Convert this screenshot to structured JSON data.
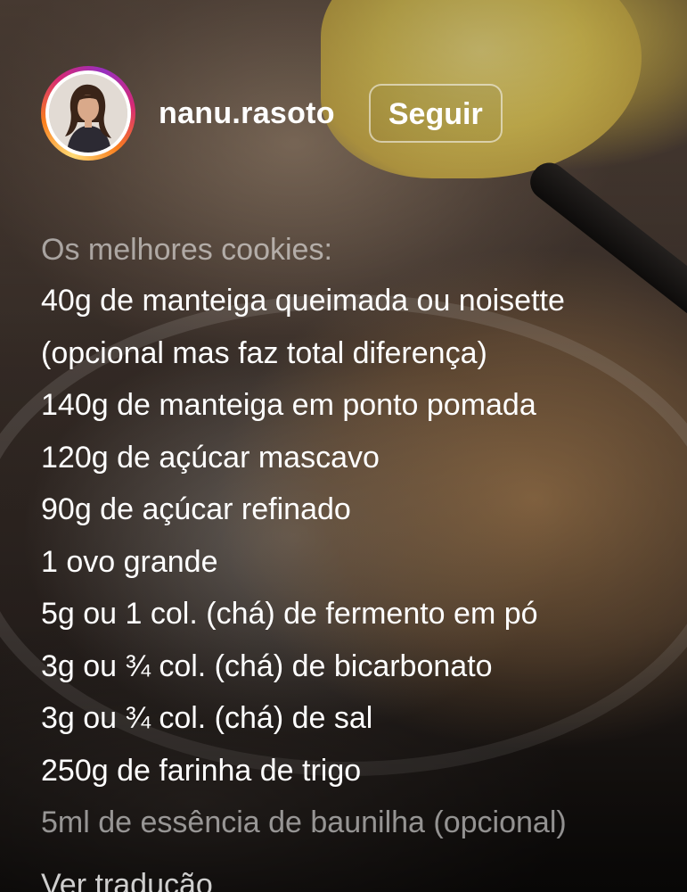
{
  "header": {
    "username": "nanu.rasoto",
    "follow_label": "Seguir",
    "avatar_icon": "profile-photo"
  },
  "caption": {
    "title": "Os melhores cookies:",
    "lines": [
      "40g de manteiga queimada ou noisette",
      "(opcional mas faz total diferença)",
      "140g de manteiga em ponto pomada",
      "120g de açúcar mascavo",
      "90g de açúcar refinado",
      "1 ovo grande",
      "5g ou 1 col. (chá) de fermento em pó",
      "3g ou ¾ col. (chá) de bicarbonato",
      "3g ou ¾ col. (chá) de sal",
      "250g de farinha de trigo",
      "5ml de essência de baunilha (opcional)"
    ]
  },
  "footer": {
    "see_translation": "Ver tradução"
  },
  "colors": {
    "story_ring": [
      "#feda75",
      "#fa7e1e",
      "#d62976",
      "#962fbf"
    ],
    "text": "#ffffff"
  }
}
